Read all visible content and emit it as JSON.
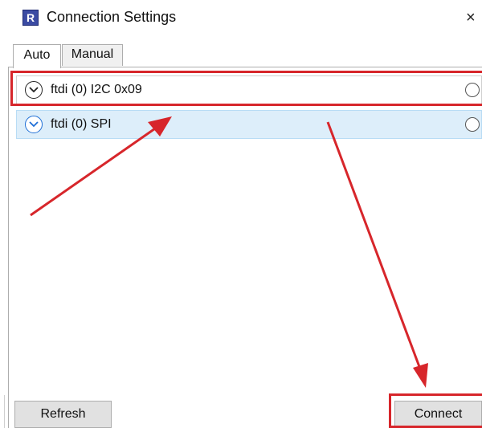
{
  "window": {
    "title": "Connection Settings",
    "app_icon_letter": "R",
    "close_glyph": "×"
  },
  "tabs": [
    {
      "label": "Auto",
      "active": true
    },
    {
      "label": "Manual",
      "active": false
    }
  ],
  "devices": [
    {
      "label": "ftdi (0) I2C 0x09",
      "selected": false,
      "highlighted_annotation": true
    },
    {
      "label": "ftdi (0) SPI",
      "selected": true,
      "highlighted_annotation": false
    }
  ],
  "buttons": {
    "refresh": "Refresh",
    "connect": "Connect"
  },
  "colors": {
    "annotation": "#d7262b",
    "selection": "#ddeefa",
    "icon_blue": "#3b4ba3"
  }
}
